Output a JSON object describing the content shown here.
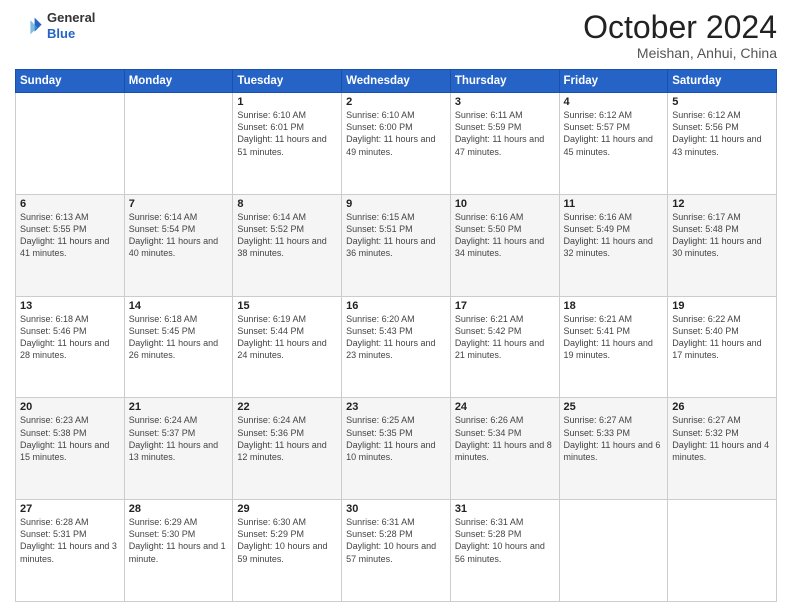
{
  "logo": {
    "general": "General",
    "blue": "Blue"
  },
  "header": {
    "month": "October 2024",
    "location": "Meishan, Anhui, China"
  },
  "weekdays": [
    "Sunday",
    "Monday",
    "Tuesday",
    "Wednesday",
    "Thursday",
    "Friday",
    "Saturday"
  ],
  "weeks": [
    [
      {
        "day": "",
        "text": ""
      },
      {
        "day": "",
        "text": ""
      },
      {
        "day": "1",
        "text": "Sunrise: 6:10 AM\nSunset: 6:01 PM\nDaylight: 11 hours and 51 minutes."
      },
      {
        "day": "2",
        "text": "Sunrise: 6:10 AM\nSunset: 6:00 PM\nDaylight: 11 hours and 49 minutes."
      },
      {
        "day": "3",
        "text": "Sunrise: 6:11 AM\nSunset: 5:59 PM\nDaylight: 11 hours and 47 minutes."
      },
      {
        "day": "4",
        "text": "Sunrise: 6:12 AM\nSunset: 5:57 PM\nDaylight: 11 hours and 45 minutes."
      },
      {
        "day": "5",
        "text": "Sunrise: 6:12 AM\nSunset: 5:56 PM\nDaylight: 11 hours and 43 minutes."
      }
    ],
    [
      {
        "day": "6",
        "text": "Sunrise: 6:13 AM\nSunset: 5:55 PM\nDaylight: 11 hours and 41 minutes."
      },
      {
        "day": "7",
        "text": "Sunrise: 6:14 AM\nSunset: 5:54 PM\nDaylight: 11 hours and 40 minutes."
      },
      {
        "day": "8",
        "text": "Sunrise: 6:14 AM\nSunset: 5:52 PM\nDaylight: 11 hours and 38 minutes."
      },
      {
        "day": "9",
        "text": "Sunrise: 6:15 AM\nSunset: 5:51 PM\nDaylight: 11 hours and 36 minutes."
      },
      {
        "day": "10",
        "text": "Sunrise: 6:16 AM\nSunset: 5:50 PM\nDaylight: 11 hours and 34 minutes."
      },
      {
        "day": "11",
        "text": "Sunrise: 6:16 AM\nSunset: 5:49 PM\nDaylight: 11 hours and 32 minutes."
      },
      {
        "day": "12",
        "text": "Sunrise: 6:17 AM\nSunset: 5:48 PM\nDaylight: 11 hours and 30 minutes."
      }
    ],
    [
      {
        "day": "13",
        "text": "Sunrise: 6:18 AM\nSunset: 5:46 PM\nDaylight: 11 hours and 28 minutes."
      },
      {
        "day": "14",
        "text": "Sunrise: 6:18 AM\nSunset: 5:45 PM\nDaylight: 11 hours and 26 minutes."
      },
      {
        "day": "15",
        "text": "Sunrise: 6:19 AM\nSunset: 5:44 PM\nDaylight: 11 hours and 24 minutes."
      },
      {
        "day": "16",
        "text": "Sunrise: 6:20 AM\nSunset: 5:43 PM\nDaylight: 11 hours and 23 minutes."
      },
      {
        "day": "17",
        "text": "Sunrise: 6:21 AM\nSunset: 5:42 PM\nDaylight: 11 hours and 21 minutes."
      },
      {
        "day": "18",
        "text": "Sunrise: 6:21 AM\nSunset: 5:41 PM\nDaylight: 11 hours and 19 minutes."
      },
      {
        "day": "19",
        "text": "Sunrise: 6:22 AM\nSunset: 5:40 PM\nDaylight: 11 hours and 17 minutes."
      }
    ],
    [
      {
        "day": "20",
        "text": "Sunrise: 6:23 AM\nSunset: 5:38 PM\nDaylight: 11 hours and 15 minutes."
      },
      {
        "day": "21",
        "text": "Sunrise: 6:24 AM\nSunset: 5:37 PM\nDaylight: 11 hours and 13 minutes."
      },
      {
        "day": "22",
        "text": "Sunrise: 6:24 AM\nSunset: 5:36 PM\nDaylight: 11 hours and 12 minutes."
      },
      {
        "day": "23",
        "text": "Sunrise: 6:25 AM\nSunset: 5:35 PM\nDaylight: 11 hours and 10 minutes."
      },
      {
        "day": "24",
        "text": "Sunrise: 6:26 AM\nSunset: 5:34 PM\nDaylight: 11 hours and 8 minutes."
      },
      {
        "day": "25",
        "text": "Sunrise: 6:27 AM\nSunset: 5:33 PM\nDaylight: 11 hours and 6 minutes."
      },
      {
        "day": "26",
        "text": "Sunrise: 6:27 AM\nSunset: 5:32 PM\nDaylight: 11 hours and 4 minutes."
      }
    ],
    [
      {
        "day": "27",
        "text": "Sunrise: 6:28 AM\nSunset: 5:31 PM\nDaylight: 11 hours and 3 minutes."
      },
      {
        "day": "28",
        "text": "Sunrise: 6:29 AM\nSunset: 5:30 PM\nDaylight: 11 hours and 1 minute."
      },
      {
        "day": "29",
        "text": "Sunrise: 6:30 AM\nSunset: 5:29 PM\nDaylight: 10 hours and 59 minutes."
      },
      {
        "day": "30",
        "text": "Sunrise: 6:31 AM\nSunset: 5:28 PM\nDaylight: 10 hours and 57 minutes."
      },
      {
        "day": "31",
        "text": "Sunrise: 6:31 AM\nSunset: 5:28 PM\nDaylight: 10 hours and 56 minutes."
      },
      {
        "day": "",
        "text": ""
      },
      {
        "day": "",
        "text": ""
      }
    ]
  ]
}
